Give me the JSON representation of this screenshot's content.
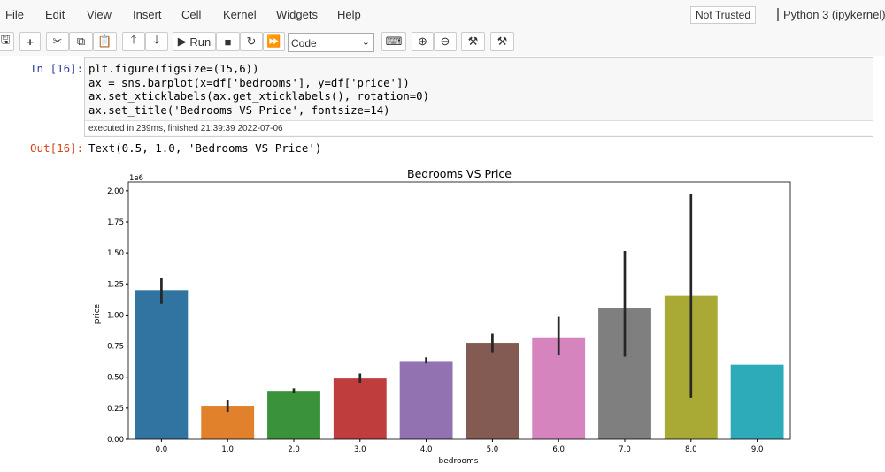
{
  "menu": [
    "File",
    "Edit",
    "View",
    "Insert",
    "Cell",
    "Kernel",
    "Widgets",
    "Help"
  ],
  "trust_label": "Not Trusted",
  "kernel_label": "Python 3 (ipykernel)",
  "toolbar": {
    "run_label": "Run",
    "cell_type": "Code"
  },
  "cell": {
    "in_prompt": "In [16]:",
    "out_prompt": "Out[16]:",
    "code": [
      "plt.figure(figsize=(15,6))",
      "ax = sns.barplot(x=df['bedrooms'], y=df['price'])",
      "ax.set_xticklabels(ax.get_xticklabels(), rotation=0)",
      "ax.set_title('Bedrooms VS Price', fontsize=14)"
    ],
    "exec_info": "executed in 239ms, finished 21:39:39 2022-07-06",
    "output_text": "Text(0.5, 1.0, 'Bedrooms VS Price')"
  },
  "chart_data": {
    "type": "bar",
    "title": "Bedrooms VS Price",
    "xlabel": "bedrooms",
    "ylabel": "price",
    "y_offset_label": "1e6",
    "categories": [
      "0.0",
      "1.0",
      "2.0",
      "3.0",
      "4.0",
      "5.0",
      "6.0",
      "7.0",
      "8.0",
      "9.0"
    ],
    "values": [
      1.2,
      0.27,
      0.39,
      0.49,
      0.63,
      0.775,
      0.82,
      1.055,
      1.155,
      0.6
    ],
    "error_low": [
      1.09,
      0.22,
      0.37,
      0.455,
      0.61,
      0.7,
      0.675,
      0.665,
      0.335,
      0.6
    ],
    "error_high": [
      1.3,
      0.32,
      0.41,
      0.53,
      0.66,
      0.85,
      0.985,
      1.515,
      1.975,
      0.6
    ],
    "yticks": [
      "0.00",
      "0.25",
      "0.50",
      "0.75",
      "1.00",
      "1.25",
      "1.50",
      "1.75",
      "2.00"
    ],
    "ylim": [
      0,
      2.07
    ],
    "grid": false,
    "colors": [
      "#3274a1",
      "#e1812c",
      "#3a923a",
      "#c03d3e",
      "#9372b2",
      "#845b53",
      "#d684bd",
      "#7f7f7f",
      "#a9aa35",
      "#2eabb8"
    ]
  }
}
